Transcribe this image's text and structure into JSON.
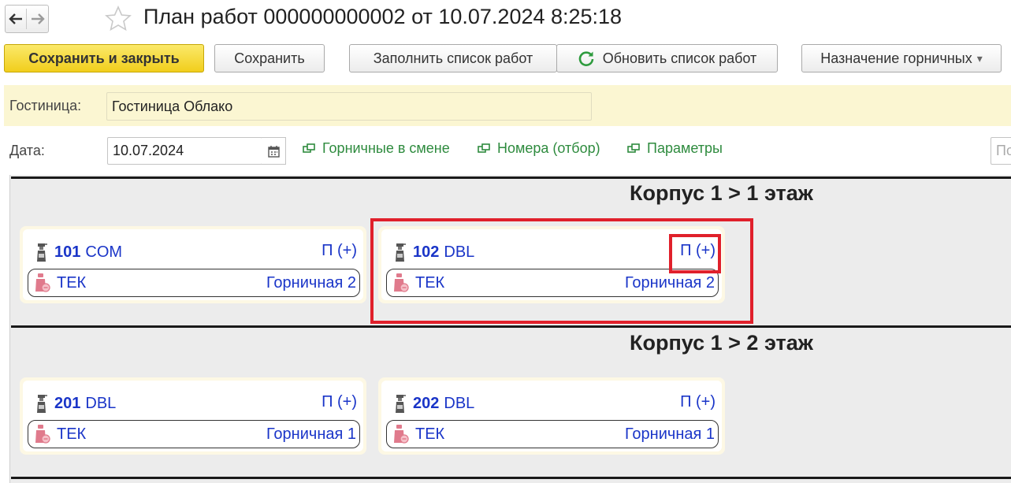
{
  "window": {
    "title": "План работ 000000000002 от 10.07.2024 8:25:18",
    "icons": {
      "back": "arrow-left-icon",
      "forward": "arrow-right-icon",
      "favorite": "star-icon"
    }
  },
  "toolbar": {
    "save_close": "Сохранить и закрыть",
    "save": "Сохранить",
    "fill_list": "Заполнить список работ",
    "refresh_list": "Обновить список работ",
    "assign_maids": "Назначение горничных",
    "assign_caret": "▾"
  },
  "form": {
    "hotel_label": "Гостиница:",
    "hotel_value": "Гостиница Облако",
    "date_label": "Дата:",
    "date_value": "10.07.2024",
    "search_placeholder": "По"
  },
  "links": {
    "maids_on_shift": "Горничные в смене",
    "rooms_filter": "Номера (отбор)",
    "parameters": "Параметры"
  },
  "floors": [
    {
      "title": "Корпус 1 > 1 этаж",
      "rooms": [
        {
          "number": "101",
          "type": "COM",
          "action": "П (+)",
          "task": "ТЕК",
          "maid": "Горничная 2"
        },
        {
          "number": "102",
          "type": "DBL",
          "action": "П (+)",
          "task": "ТЕК",
          "maid": "Горничная 2"
        }
      ]
    },
    {
      "title": "Корпус 1 > 2 этаж",
      "rooms": [
        {
          "number": "201",
          "type": "DBL",
          "action": "П (+)",
          "task": "ТЕК",
          "maid": "Горничная 1"
        },
        {
          "number": "202",
          "type": "DBL",
          "action": "П (+)",
          "task": "ТЕК",
          "maid": "Горничная 1"
        }
      ]
    }
  ],
  "colors": {
    "accent_yellow": "#f1ce1c",
    "link_green": "#2e8b3e",
    "room_blue": "#1a35c8",
    "highlight_red": "#e0202b",
    "hotel_band": "#fbf6d2"
  }
}
